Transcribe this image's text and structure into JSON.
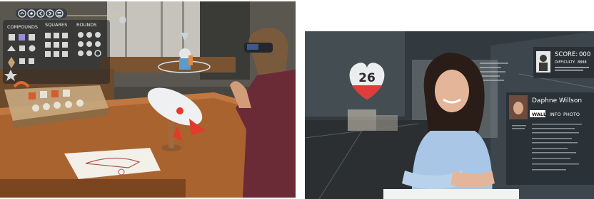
{
  "left": {
    "toolbar_buttons": [
      "home-icon",
      "settings-icon",
      "back-icon",
      "forward-icon",
      "menu-icon"
    ],
    "shape_library": {
      "tabs": [
        "COMPOUNDS",
        "SQUARES",
        "ROUNDS"
      ]
    }
  },
  "right": {
    "heart_counter": {
      "value": "26",
      "color": "#e23b3b"
    },
    "score_card": {
      "score_label": "SCORE:",
      "score_value": "000",
      "difficulty_label": "DIFFICULTY:",
      "difficulty_value": "8888"
    },
    "profile_card": {
      "name": "Daphne Willson",
      "tabs": [
        "WALL",
        "INFO",
        "PHOTO"
      ]
    }
  }
}
